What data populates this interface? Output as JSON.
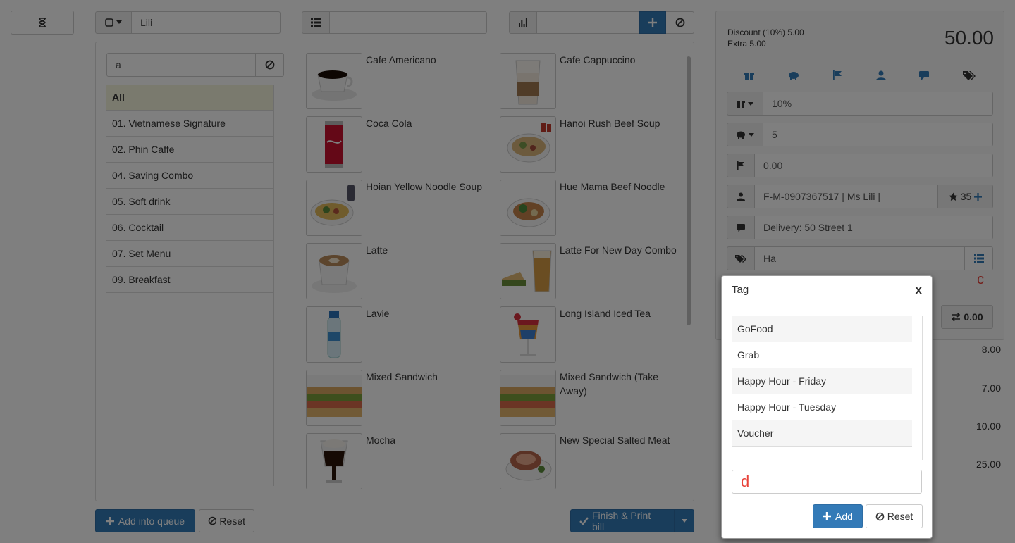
{
  "toolbar": {
    "timer_icon": "hourglass-icon",
    "table_icon": "square-icon",
    "customer_field": "Lili",
    "list_field": "",
    "qty_field": ""
  },
  "categories": {
    "search_value": "a",
    "items": [
      {
        "label": "All",
        "active": true
      },
      {
        "label": "01. Vietnamese Signature"
      },
      {
        "label": "02. Phin Caffe"
      },
      {
        "label": "04. Saving Combo"
      },
      {
        "label": "05. Soft drink"
      },
      {
        "label": "06. Cocktail"
      },
      {
        "label": "07. Set Menu"
      },
      {
        "label": "09. Breakfast"
      }
    ]
  },
  "products": [
    {
      "name": "Cafe Americano"
    },
    {
      "name": "Cafe Cappuccino"
    },
    {
      "name": "Coca Cola"
    },
    {
      "name": "Hanoi Rush Beef Soup"
    },
    {
      "name": "Hoian Yellow Noodle Soup"
    },
    {
      "name": "Hue Mama Beef Noodle"
    },
    {
      "name": "Latte"
    },
    {
      "name": "Latte For New Day Combo"
    },
    {
      "name": "Lavie"
    },
    {
      "name": "Long Island Iced Tea"
    },
    {
      "name": "Mixed Sandwich"
    },
    {
      "name": "Mixed Sandwich (Take Away)"
    },
    {
      "name": "Mocha"
    },
    {
      "name": "New Special Salted Meat"
    }
  ],
  "footer": {
    "add_queue": "Add into queue",
    "reset": "Reset",
    "finish": "Finish & Print bill"
  },
  "bill": {
    "discount_line": "Discount (10%) 5.00",
    "extra_line": "Extra 5.00",
    "total": "50.00",
    "discount_value": "10%",
    "extra_value": "5",
    "flag_value": "0.00",
    "customer_value": "F-M-0907367517 | Ms Lili |",
    "customer_points": "35",
    "note_value": "Delivery: 50 Street 1",
    "tag_value": "Ha",
    "annotation_c": "c",
    "transfer_value": "0.00",
    "line_amounts": [
      "8.00",
      "7.00",
      "10.00",
      "25.00"
    ]
  },
  "modal": {
    "title": "Tag",
    "close": "x",
    "tags": [
      "GoFood",
      "Grab",
      "Happy Hour - Friday",
      "Happy Hour - Tuesday",
      "Voucher"
    ],
    "input_value": "d",
    "add_label": "Add",
    "reset_label": "Reset"
  },
  "colors": {
    "primary": "#337ab7",
    "annotation": "#e8433a"
  }
}
